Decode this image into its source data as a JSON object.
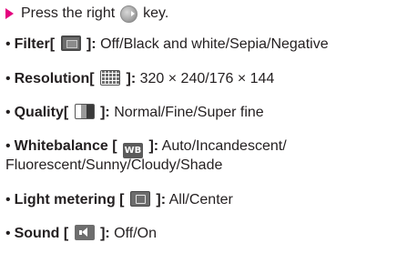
{
  "intro": {
    "before_icon": "Press the right",
    "after_icon": "key.",
    "arrow_color": "#e4007f",
    "key_icon": "round-navigation-key-icon"
  },
  "bullet": "•",
  "open_bracket": "[",
  "close_bracket": "]:",
  "settings": [
    {
      "label": "Filter",
      "icon": "filter-icon",
      "values": "Off/Black and white/Sepia/Negative"
    },
    {
      "label": "Resolution",
      "icon": "resolution-icon",
      "values": "320 × 240/176 × 144"
    },
    {
      "label": "Quality",
      "icon": "quality-icon",
      "values": "Normal/Fine/Super fine"
    },
    {
      "label": "Whitebalance",
      "icon": "whitebalance-icon",
      "icon_text": "WB",
      "values_line1": "Auto/Incandescent/",
      "values_line2": "Fluorescent/Sunny/Cloudy/Shade"
    },
    {
      "label": "Light metering",
      "icon": "light-metering-icon",
      "values": "All/Center"
    },
    {
      "label": "Sound",
      "icon": "sound-icon",
      "values": "Off/On"
    }
  ]
}
